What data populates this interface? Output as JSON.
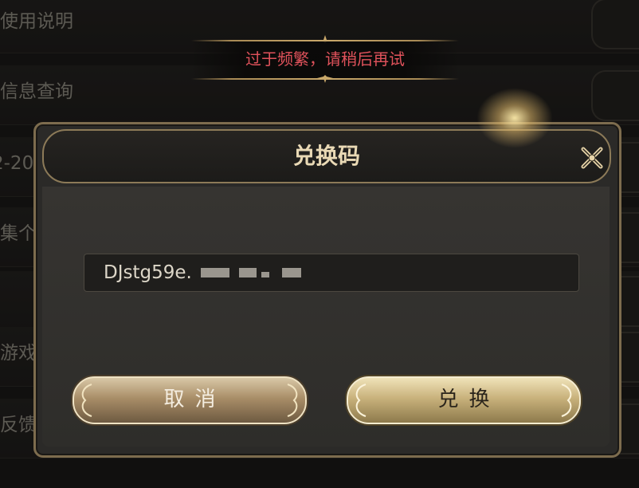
{
  "background_menu": {
    "items": [
      {
        "label": "使用说明"
      },
      {
        "label": "信息查询"
      },
      {
        "label": "2-20"
      },
      {
        "label": "集个"
      },
      {
        "label": ""
      },
      {
        "label": "游戏"
      },
      {
        "label": "反馈"
      }
    ]
  },
  "toast": {
    "message": "过于频繁，请稍后再试",
    "color": "#e0525b"
  },
  "dialog": {
    "title": "兑换码",
    "close_icon": "close-x-icon",
    "code_input": {
      "value": "DJstg59e."
    },
    "cancel_label": "取消",
    "confirm_label": "兑换"
  },
  "colors": {
    "accent_gold": "#c9b27c",
    "border_gold": "#8c7a58",
    "title_text": "#e9d9b5"
  }
}
